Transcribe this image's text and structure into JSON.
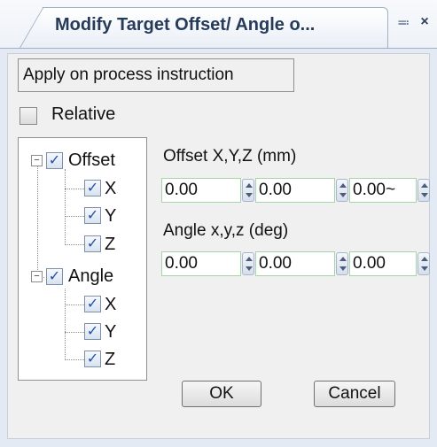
{
  "panel": {
    "title": "Modify Target Offset/ Angle o...",
    "pin_glyph": "₹",
    "close_glyph": "×"
  },
  "apply_label": "Apply on process instruction",
  "relative": {
    "label": "Relative",
    "checked": false
  },
  "tree": {
    "expand_glyph": "−",
    "check_glyph": "✓",
    "offset": {
      "label": "Offset",
      "children": [
        "X",
        "Y",
        "Z"
      ]
    },
    "angle": {
      "label": "Angle",
      "children": [
        "X",
        "Y",
        "Z"
      ]
    }
  },
  "offset": {
    "label": "Offset X,Y,Z (mm)",
    "x": "0.00",
    "y": "0.00",
    "z": "0.00~"
  },
  "angle": {
    "label": "Angle x,y,z (deg)",
    "x": "0.00",
    "y": "0.00",
    "z": "0.00"
  },
  "buttons": {
    "ok": "OK",
    "cancel": "Cancel"
  }
}
